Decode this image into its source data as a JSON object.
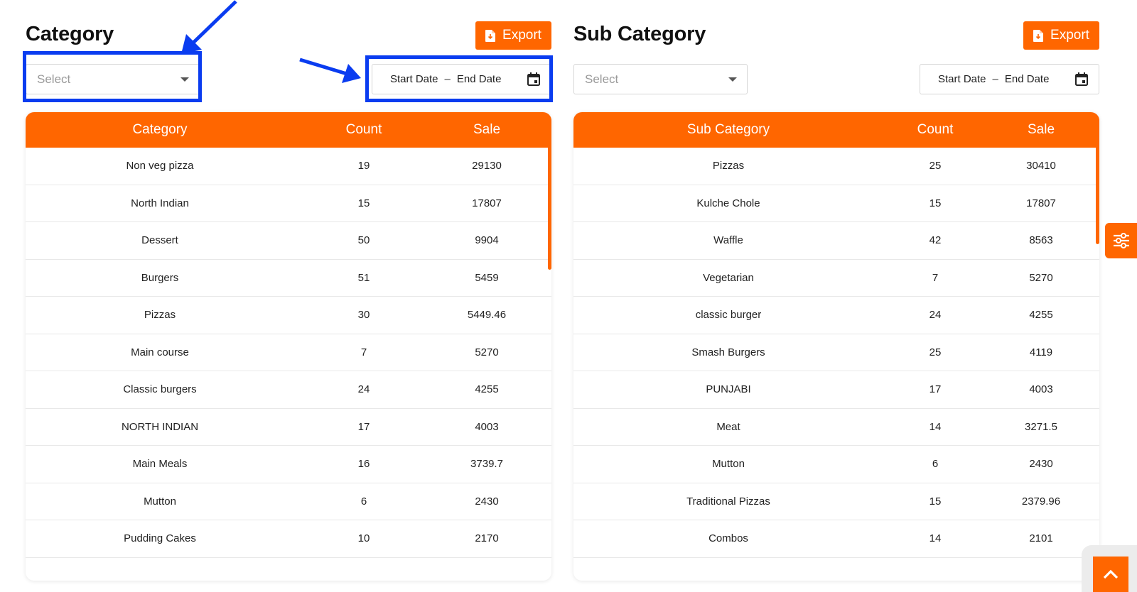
{
  "colors": {
    "accent": "#ff6600",
    "annotation": "#0a3cf0"
  },
  "category": {
    "title": "Category",
    "export_label": "Export",
    "select_placeholder": "Select",
    "date_start": "Start Date",
    "date_separator": "–",
    "date_end": "End Date",
    "headers": [
      "Category",
      "Count",
      "Sale"
    ],
    "rows": [
      [
        "Non veg pizza",
        "19",
        "29130"
      ],
      [
        "North Indian",
        "15",
        "17807"
      ],
      [
        "Dessert",
        "50",
        "9904"
      ],
      [
        "Burgers",
        "51",
        "5459"
      ],
      [
        "Pizzas",
        "30",
        "5449.46"
      ],
      [
        "Main course",
        "7",
        "5270"
      ],
      [
        "Classic burgers",
        "24",
        "4255"
      ],
      [
        "NORTH INDIAN",
        "17",
        "4003"
      ],
      [
        "Main Meals",
        "16",
        "3739.7"
      ],
      [
        "Mutton",
        "6",
        "2430"
      ],
      [
        "Pudding Cakes",
        "10",
        "2170"
      ]
    ]
  },
  "sub_category": {
    "title": "Sub Category",
    "export_label": "Export",
    "select_placeholder": "Select",
    "date_start": "Start Date",
    "date_separator": "–",
    "date_end": "End Date",
    "headers": [
      "Sub Category",
      "Count",
      "Sale"
    ],
    "rows": [
      [
        "Pizzas",
        "25",
        "30410"
      ],
      [
        "Kulche Chole",
        "15",
        "17807"
      ],
      [
        "Waffle",
        "42",
        "8563"
      ],
      [
        "Vegetarian",
        "7",
        "5270"
      ],
      [
        "classic burger",
        "24",
        "4255"
      ],
      [
        "Smash Burgers",
        "25",
        "4119"
      ],
      [
        "PUNJABI",
        "17",
        "4003"
      ],
      [
        "Meat",
        "14",
        "3271.5"
      ],
      [
        "Mutton",
        "6",
        "2430"
      ],
      [
        "Traditional Pizzas",
        "15",
        "2379.96"
      ],
      [
        "Combos",
        "14",
        "2101"
      ]
    ]
  },
  "icons": {
    "export": "file-export-icon",
    "calendar": "calendar-icon",
    "caret": "caret-down-icon",
    "settings_tab": "sliders-icon",
    "scroll_top": "chevron-up-icon"
  }
}
